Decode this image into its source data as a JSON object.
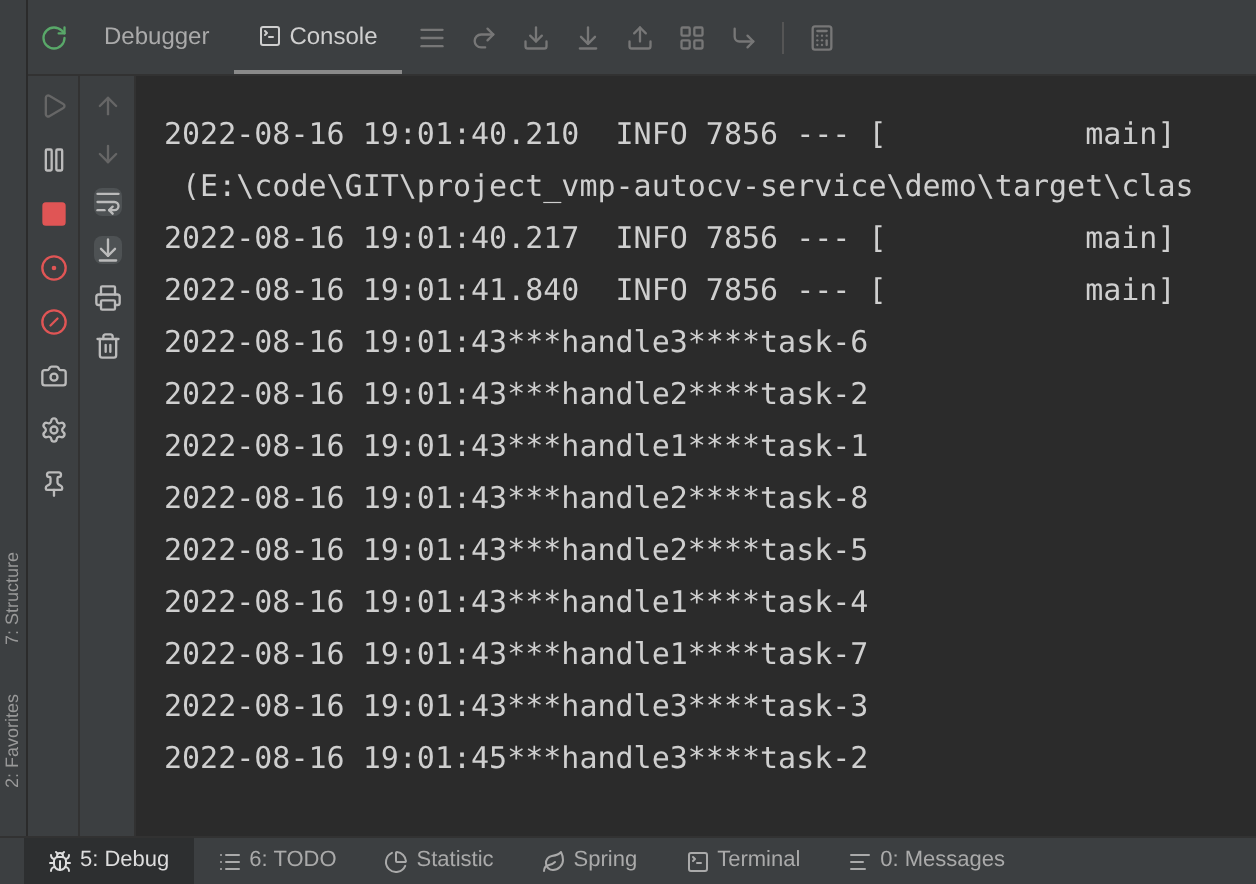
{
  "tabs": [
    {
      "label": "Debugger",
      "selected": false,
      "icon": false
    },
    {
      "label": "Console",
      "selected": true,
      "icon": true
    }
  ],
  "side_tabs": [
    "7: Structure",
    "2: Favorites"
  ],
  "console_lines": [
    "2022-08-16 19:01:40.210  INFO 7856 --- [           main]",
    " (E:\\code\\GIT\\project_vmp-autocv-service\\demo\\target\\clas",
    "2022-08-16 19:01:40.217  INFO 7856 --- [           main]",
    "2022-08-16 19:01:41.840  INFO 7856 --- [           main]",
    "2022-08-16 19:01:43***handle3****task-6",
    "2022-08-16 19:01:43***handle2****task-2",
    "2022-08-16 19:01:43***handle1****task-1",
    "2022-08-16 19:01:43***handle2****task-8",
    "2022-08-16 19:01:43***handle2****task-5",
    "2022-08-16 19:01:43***handle1****task-4",
    "2022-08-16 19:01:43***handle1****task-7",
    "2022-08-16 19:01:43***handle3****task-3",
    "2022-08-16 19:01:45***handle3****task-2"
  ],
  "bottom_tabs": [
    {
      "label": "5: Debug",
      "kind": "debug",
      "selected": true
    },
    {
      "label": "6: TODO",
      "kind": "todo",
      "selected": false
    },
    {
      "label": "Statistic",
      "kind": "statistic",
      "selected": false
    },
    {
      "label": "Spring",
      "kind": "spring",
      "selected": false
    },
    {
      "label": "Terminal",
      "kind": "terminal",
      "selected": false
    },
    {
      "label": "0: Messages",
      "kind": "messages",
      "selected": false
    }
  ]
}
